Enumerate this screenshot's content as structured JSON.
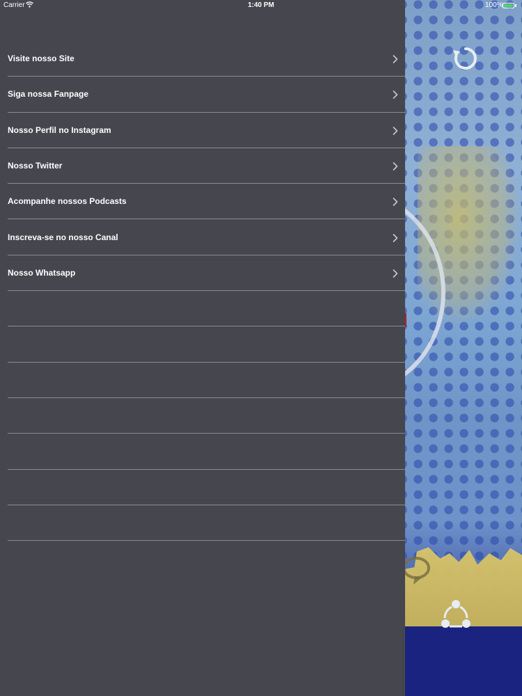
{
  "status_bar": {
    "carrier": "Carrier",
    "time": "1:40 PM",
    "battery": "100%",
    "battery_color": "#4cd964"
  },
  "menu": {
    "background": "#45464e",
    "items": [
      {
        "label": "Visite nosso Site"
      },
      {
        "label": "Siga nossa Fanpage"
      },
      {
        "label": "Nosso Perfil no Instagram"
      },
      {
        "label": "Nosso Twitter"
      },
      {
        "label": "Acompanhe nossos Podcasts"
      },
      {
        "label": "Inscreva-se no nosso Canal"
      },
      {
        "label": "Nosso Whatsapp"
      },
      {
        "label": ""
      },
      {
        "label": ""
      },
      {
        "label": ""
      },
      {
        "label": ""
      },
      {
        "label": ""
      },
      {
        "label": ""
      },
      {
        "label": ""
      }
    ],
    "chevron_icon": "chevron-right-icon"
  },
  "background_app": {
    "icons": [
      "refresh-icon",
      "share-icon",
      "chat-bubble-icon"
    ]
  }
}
